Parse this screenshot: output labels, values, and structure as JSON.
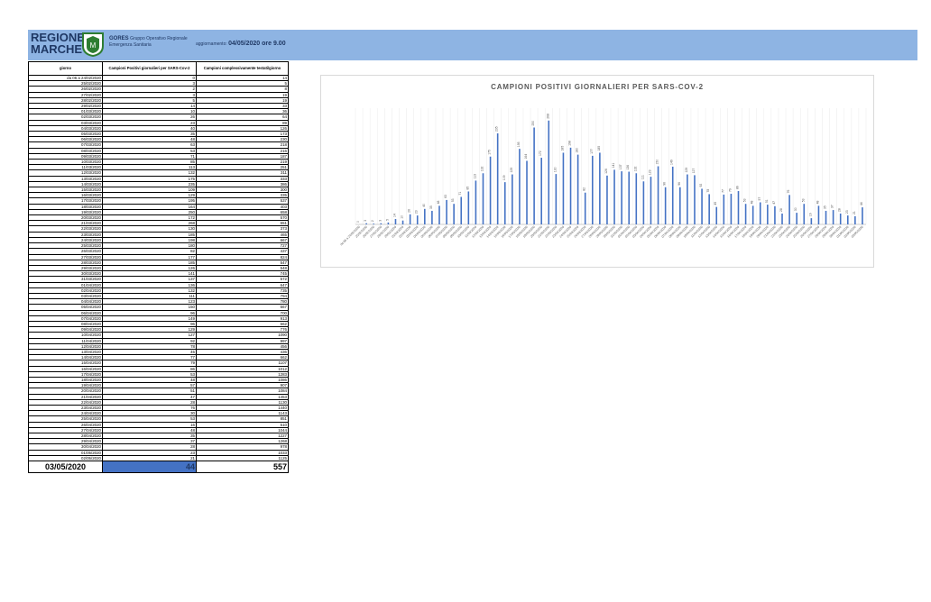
{
  "header": {
    "logo_line1": "REGIONE",
    "logo_line2": "MARCHE",
    "org_name": "GORES",
    "org_line1": "Gruppo Operativo Regionale",
    "org_line2": "Emergenza Sanitaria",
    "update_label": "aggiornamento:",
    "update_value": "04/05/2020 ore 9.00"
  },
  "table": {
    "headers": [
      "giorno",
      "Campioni Positivi giornalieri per SARS-Cov-2",
      "Campioni complessivamente testati/giorno"
    ],
    "rows": [
      [
        "da 06 a 24/02/2020",
        "0",
        "14"
      ],
      [
        "25/02/2020",
        "3",
        "5"
      ],
      [
        "26/02/2020",
        "2",
        "8"
      ],
      [
        "27/02/2020",
        "3",
        "19"
      ],
      [
        "28/02/2020",
        "5",
        "19"
      ],
      [
        "29/02/2020",
        "14",
        "33"
      ],
      [
        "01/03/2020",
        "10",
        "36"
      ],
      [
        "02/03/2020",
        "26",
        "64"
      ],
      [
        "03/03/2020",
        "23",
        "89"
      ],
      [
        "04/03/2020",
        "40",
        "126"
      ],
      [
        "05/03/2020",
        "35",
        "173"
      ],
      [
        "06/03/2020",
        "48",
        "230"
      ],
      [
        "07/03/2020",
        "63",
        "218"
      ],
      [
        "08/03/2020",
        "53",
        "216"
      ],
      [
        "09/03/2020",
        "71",
        "187"
      ],
      [
        "10/03/2020",
        "85",
        "219"
      ],
      [
        "11/03/2020",
        "113",
        "251"
      ],
      [
        "12/03/2020",
        "132",
        "311"
      ],
      [
        "13/03/2020",
        "175",
        "333"
      ],
      [
        "14/03/2020",
        "235",
        "386"
      ],
      [
        "15/03/2020",
        "109",
        "300"
      ],
      [
        "16/03/2020",
        "129",
        "335"
      ],
      [
        "17/03/2020",
        "195",
        "537"
      ],
      [
        "18/03/2020",
        "164",
        "403"
      ],
      [
        "19/03/2020",
        "250",
        "658"
      ],
      [
        "20/03/2020",
        "172",
        "570"
      ],
      [
        "21/03/2020",
        "268",
        "651"
      ],
      [
        "22/03/2020",
        "130",
        "373"
      ],
      [
        "23/03/2020",
        "185",
        "465"
      ],
      [
        "24/03/2020",
        "198",
        "667"
      ],
      [
        "25/03/2020",
        "180",
        "727"
      ],
      [
        "26/03/2020",
        "82",
        "437"
      ],
      [
        "27/03/2020",
        "177",
        "824"
      ],
      [
        "28/03/2020",
        "185",
        "547"
      ],
      [
        "29/03/2020",
        "126",
        "548"
      ],
      [
        "30/03/2020",
        "141",
        "745"
      ],
      [
        "31/03/2020",
        "137",
        "572"
      ],
      [
        "01/04/2020",
        "136",
        "647"
      ],
      [
        "02/04/2020",
        "132",
        "735"
      ],
      [
        "03/04/2020",
        "111",
        "794"
      ],
      [
        "04/04/2020",
        "123",
        "780"
      ],
      [
        "05/04/2020",
        "150",
        "667"
      ],
      [
        "06/04/2020",
        "96",
        "700"
      ],
      [
        "07/04/2020",
        "149",
        "913"
      ],
      [
        "08/04/2020",
        "96",
        "662"
      ],
      [
        "09/04/2020",
        "129",
        "776"
      ],
      [
        "10/04/2020",
        "127",
        "1090"
      ],
      [
        "11/04/2020",
        "92",
        "997"
      ],
      [
        "12/04/2020",
        "78",
        "456"
      ],
      [
        "13/04/2020",
        "45",
        "436"
      ],
      [
        "14/04/2020",
        "77",
        "662"
      ],
      [
        "15/04/2020",
        "79",
        "1107"
      ],
      [
        "16/04/2020",
        "86",
        "1012"
      ],
      [
        "17/04/2020",
        "53",
        "1283"
      ],
      [
        "18/04/2020",
        "48",
        "1086"
      ],
      [
        "19/04/2020",
        "57",
        "907"
      ],
      [
        "20/04/2020",
        "51",
        "1084"
      ],
      [
        "21/04/2020",
        "47",
        "1453"
      ],
      [
        "22/04/2020",
        "28",
        "1130"
      ],
      [
        "23/04/2020",
        "76",
        "1440"
      ],
      [
        "24/04/2020",
        "30",
        "1143"
      ],
      [
        "25/04/2020",
        "53",
        "851"
      ],
      [
        "26/04/2020",
        "16",
        "510"
      ],
      [
        "27/04/2020",
        "48",
        "1044"
      ],
      [
        "28/04/2020",
        "35",
        "1227"
      ],
      [
        "29/04/2020",
        "37",
        "1268"
      ],
      [
        "30/04/2020",
        "28",
        "978"
      ],
      [
        "01/05/2020",
        "23",
        "1033"
      ],
      [
        "02/05/2020",
        "21",
        "1125"
      ]
    ],
    "total_row": [
      "03/05/2020",
      "44",
      "557"
    ]
  },
  "chart_data": {
    "type": "bar",
    "title": "CAMPIONI POSITIVI GIORNALIERI PER SARS-COV-2",
    "categories": [
      "da 06 a 24/02/2020",
      "25/02/2020",
      "26/02/2020",
      "27/02/2020",
      "28/02/2020",
      "29/02/2020",
      "01/03/2020",
      "02/03/2020",
      "03/03/2020",
      "04/03/2020",
      "05/03/2020",
      "06/03/2020",
      "07/03/2020",
      "08/03/2020",
      "09/03/2020",
      "10/03/2020",
      "11/03/2020",
      "12/03/2020",
      "13/03/2020",
      "14/03/2020",
      "15/03/2020",
      "16/03/2020",
      "17/03/2020",
      "18/03/2020",
      "19/03/2020",
      "20/03/2020",
      "21/03/2020",
      "22/03/2020",
      "23/03/2020",
      "24/03/2020",
      "25/03/2020",
      "26/03/2020",
      "27/03/2020",
      "28/03/2020",
      "29/03/2020",
      "30/03/2020",
      "31/03/2020",
      "01/04/2020",
      "02/04/2020",
      "03/04/2020",
      "04/04/2020",
      "05/04/2020",
      "06/04/2020",
      "07/04/2020",
      "08/04/2020",
      "09/04/2020",
      "10/04/2020",
      "11/04/2020",
      "12/04/2020",
      "13/04/2020",
      "14/04/2020",
      "15/04/2020",
      "16/04/2020",
      "17/04/2020",
      "18/04/2020",
      "19/04/2020",
      "20/04/2020",
      "21/04/2020",
      "22/04/2020",
      "23/04/2020",
      "24/04/2020",
      "25/04/2020",
      "26/04/2020",
      "27/04/2020",
      "28/04/2020",
      "29/04/2020",
      "30/04/2020",
      "01/05/2020",
      "02/05/2020",
      "03/05/2020"
    ],
    "values": [
      0,
      3,
      2,
      3,
      5,
      14,
      10,
      26,
      23,
      40,
      35,
      48,
      63,
      53,
      71,
      85,
      113,
      132,
      175,
      235,
      109,
      129,
      195,
      164,
      250,
      172,
      268,
      130,
      185,
      198,
      180,
      82,
      177,
      185,
      126,
      141,
      137,
      136,
      132,
      111,
      123,
      150,
      96,
      149,
      96,
      129,
      127,
      92,
      78,
      45,
      77,
      79,
      86,
      53,
      48,
      57,
      51,
      47,
      28,
      76,
      30,
      53,
      16,
      48,
      35,
      37,
      28,
      23,
      21,
      44
    ],
    "ylim": [
      0,
      300
    ],
    "grid": true,
    "bar_color": "#4472c4",
    "data_labels": true
  }
}
